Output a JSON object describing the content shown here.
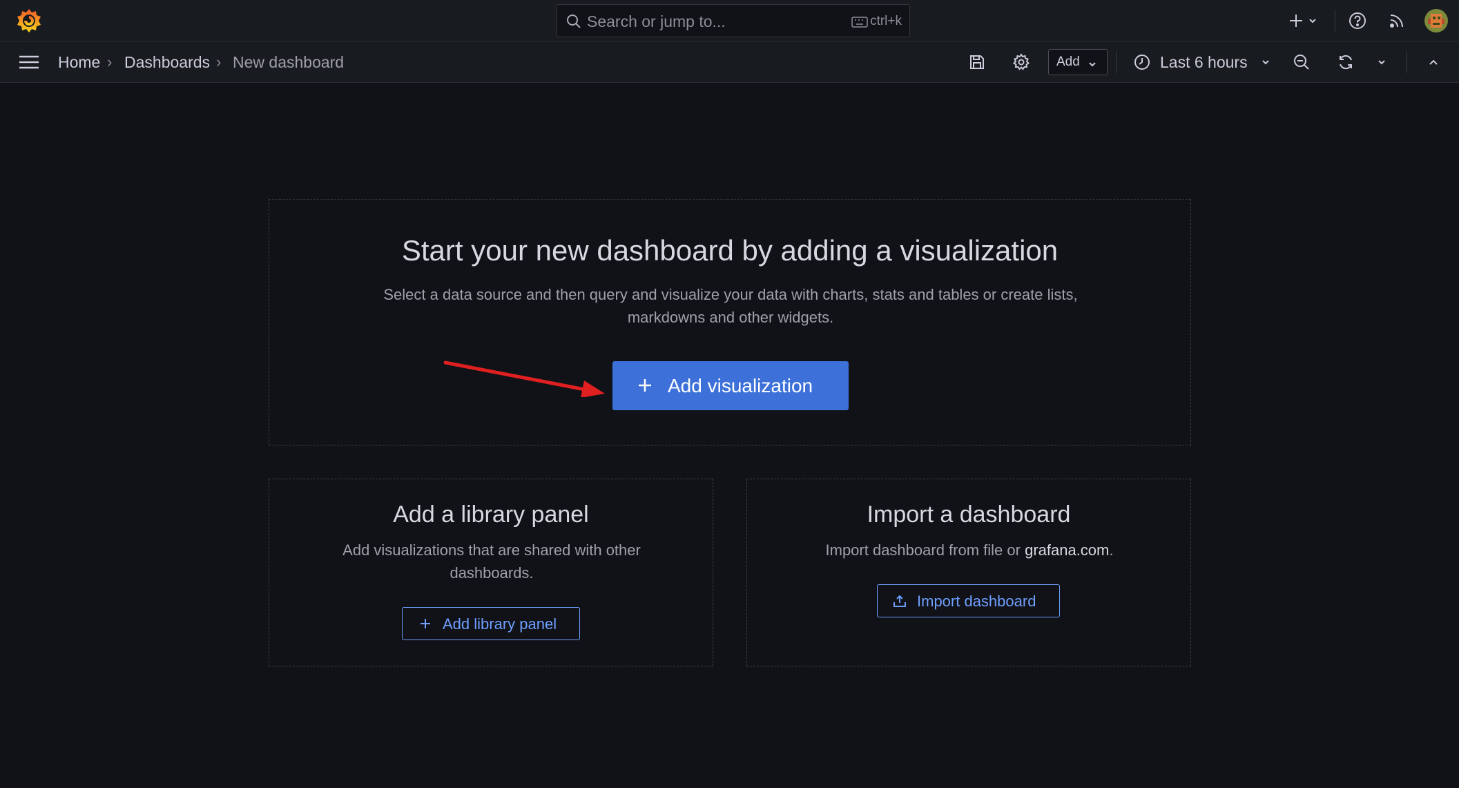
{
  "topbar": {
    "search_placeholder": "Search or jump to...",
    "search_shortcut": "ctrl+k",
    "icons": [
      "grafana-logo-icon",
      "search-icon",
      "keyboard-icon",
      "plus-icon",
      "chevron-down-icon",
      "help-icon",
      "news-feed-icon",
      "user-avatar"
    ]
  },
  "breadcrumb": {
    "items": [
      "Home",
      "Dashboards",
      "New dashboard"
    ]
  },
  "toolbar": {
    "add_label": "Add",
    "time_range": "Last 6 hours"
  },
  "main_panel": {
    "title": "Start your new dashboard by adding a visualization",
    "description_line1": "Select a data source and then query and visualize your data with charts, stats and tables or create lists,",
    "description_line2": "markdowns and other widgets.",
    "button_label": "Add visualization"
  },
  "library_panel": {
    "title": "Add a library panel",
    "description_line1": "Add visualizations that are shared with other",
    "description_line2": "dashboards.",
    "button_label": "Add library panel"
  },
  "import_panel": {
    "title": "Import a dashboard",
    "description_prefix": "Import dashboard from file or ",
    "description_link": "grafana.com",
    "description_suffix": ".",
    "button_label": "Import dashboard"
  },
  "colors": {
    "background": "#111217",
    "bar": "#181b1f",
    "primary": "#3d71d9",
    "link": "#6e9fff",
    "annotation_arrow": "#e02020"
  }
}
